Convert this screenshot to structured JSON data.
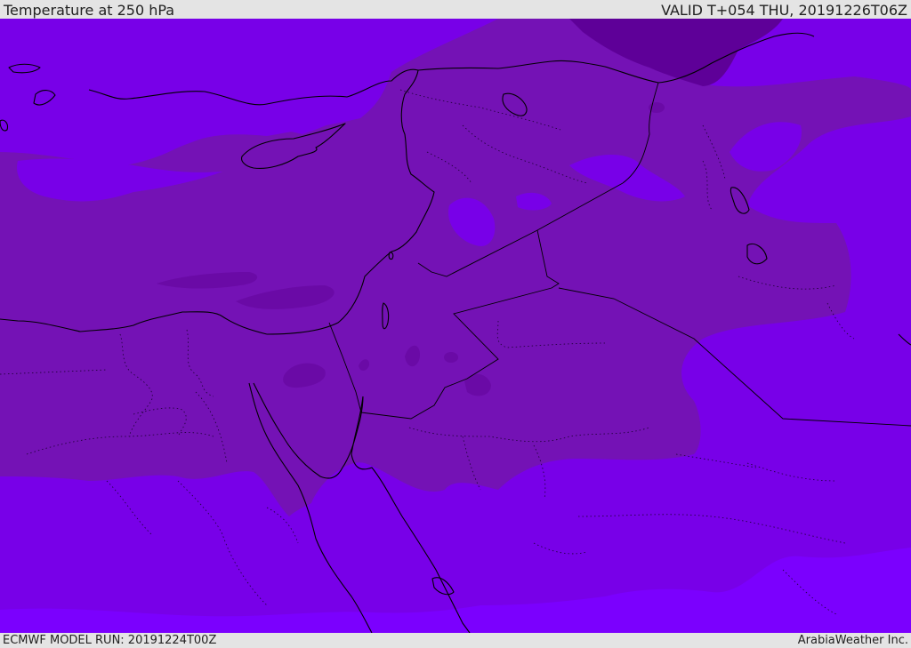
{
  "header": {
    "title": "Temperature at 250 hPa",
    "valid": "VALID T+054 THU, 20191226T06Z"
  },
  "footer": {
    "model_run": "ECMWF MODEL RUN: 20191224T00Z",
    "credit": "ArabiaWeather Inc."
  },
  "map": {
    "field": "temperature",
    "level": "250 hPa",
    "colors": {
      "band_warmest": "#7b00fe",
      "band_warm": "#7800e8",
      "band_mid": "#7412b5",
      "band_cold": "#6a0aa6",
      "band_coldest": "#5e0098",
      "coast": "#000000",
      "border": "#1a0030"
    }
  }
}
